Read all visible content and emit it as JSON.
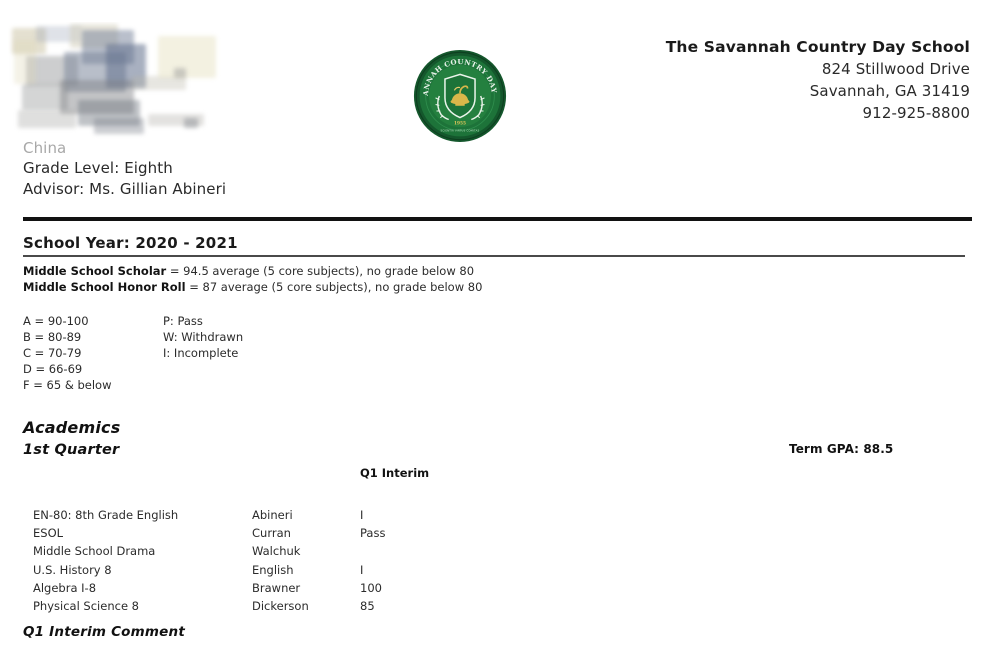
{
  "document": {
    "type": "report-card"
  },
  "school": {
    "name": "The Savannah Country Day School",
    "address_line1": "824 Stillwood Drive",
    "address_line2": "Savannah, GA 31419",
    "phone": "912-925-8800",
    "seal": {
      "arc_text": "THE SAVANNAH COUNTRY DAY SCHOOL",
      "year": "1955",
      "color_dark": "#166032",
      "color_mid": "#1f7a3d",
      "color_light": "#2e8b4f",
      "color_gold": "#d9b74a"
    }
  },
  "student": {
    "country": "China",
    "grade_level": "Grade Level: Eighth",
    "advisor": "Advisor: Ms. Gillian Abineri"
  },
  "school_year": {
    "label": "School Year:  2020 - 2021"
  },
  "honors": [
    {
      "label": "Middle School Scholar",
      "detail": " = 94.5 average (5 core subjects), no grade below 80"
    },
    {
      "label": "Middle School Honor Roll",
      "detail": " = 87 average (5 core subjects), no grade below 80"
    }
  ],
  "grade_scale": {
    "letters": [
      "A = 90-100",
      "B = 80-89",
      "C = 70-79",
      "D = 66-69",
      "F = 65 & below"
    ],
    "codes": [
      "P:  Pass",
      "W:  Withdrawn",
      "I:  Incomplete"
    ]
  },
  "academics": {
    "section_title": "Academics",
    "quarter_title": "1st Quarter",
    "term_gpa": "Term GPA: 88.5",
    "columns": {
      "course": "",
      "teacher": "",
      "grade": "Q1 Interim"
    },
    "rows": [
      {
        "course": "EN-80: 8th Grade English",
        "teacher": "Abineri",
        "grade": "I"
      },
      {
        "course": "ESOL",
        "teacher": "Curran",
        "grade": "Pass"
      },
      {
        "course": "Middle School Drama",
        "teacher": "Walchuk",
        "grade": ""
      },
      {
        "course": "U.S. History 8",
        "teacher": "English",
        "grade": "I"
      },
      {
        "course": "Algebra I-8",
        "teacher": "Brawner",
        "grade": "100"
      },
      {
        "course": "Physical Science 8",
        "teacher": "Dickerson",
        "grade": "85"
      }
    ],
    "comment_title": "Q1 Interim Comment"
  }
}
